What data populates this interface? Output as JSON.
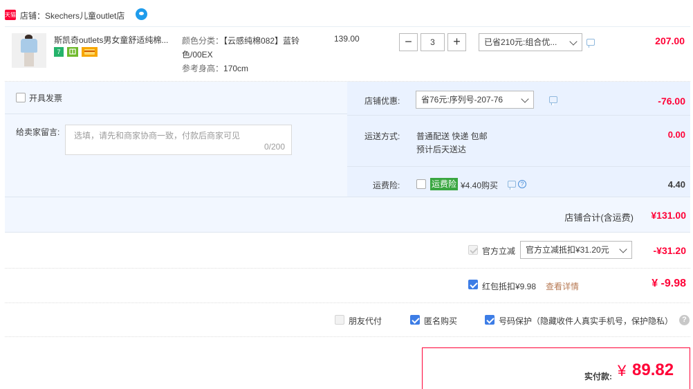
{
  "shop": {
    "tmall_badge": "天猫",
    "name": "店铺：Skechers儿童outlet店"
  },
  "item": {
    "title": "斯凯奇outlets男女童舒适纯棉...",
    "badges": [
      "7",
      "",
      ""
    ],
    "sku_label1": "颜色分类：",
    "sku_value1": "【云感纯棉082】蓝铃",
    "sku_value1b": "色/00EX",
    "sku_label2": "参考身高：",
    "sku_value2": "170cm",
    "unit_price": "139.00",
    "qty_minus": "−",
    "qty": "3",
    "qty_plus": "+",
    "promo_select": "已省210元:组合优...",
    "subtotal": "207.00"
  },
  "invoice": {
    "label": "开具发票"
  },
  "message": {
    "label": "给卖家留言:",
    "placeholder": "选填，请先和商家协商一致，付款后商家可见",
    "counter": "0/200"
  },
  "shop_discount": {
    "label": "店铺优惠:",
    "select": "省76元:序列号-207-76",
    "amount": "-76.00"
  },
  "shipping": {
    "label": "运送方式:",
    "method": "普通配送 快递 包邮",
    "eta": "预计后天送达",
    "amount": "0.00"
  },
  "insurance": {
    "label": "运费险:",
    "tag": "运费险",
    "price": "¥4.40购买",
    "help": "?",
    "amount": "4.40"
  },
  "shop_total": {
    "label": "店铺合计(含运费)",
    "amount": "¥131.00"
  },
  "official_discount": {
    "label": "官方立减",
    "select": "官方立减抵扣¥31.20元",
    "amount": "-¥31.20"
  },
  "red_packet": {
    "label": "红包抵扣¥9.98",
    "link": "查看详情",
    "amount": "¥ -9.98"
  },
  "options": {
    "friend_pay": "朋友代付",
    "anonymous": "匿名购买",
    "number_protect": "号码保护（隐藏收件人真实手机号，保护隐私）",
    "help": "?"
  },
  "pay": {
    "label": "实付款:",
    "currency": "¥",
    "amount": "89.82"
  },
  "colors": {
    "accent_red": "#ff0036",
    "checkbox_blue": "#3d7de6",
    "panel_bg": "#f2f7ff",
    "insurance_green": "#39a640"
  }
}
